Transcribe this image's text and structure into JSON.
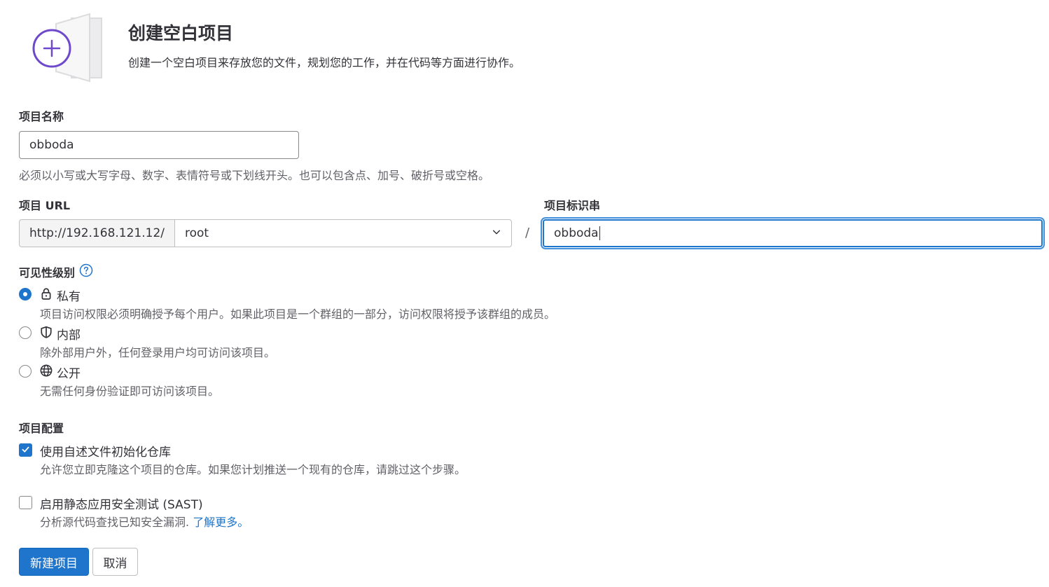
{
  "header": {
    "title": "创建空白项目",
    "description": "创建一个空白项目来存放您的文件，规划您的工作，并在代码等方面进行协作。"
  },
  "project_name": {
    "label": "项目名称",
    "value": "obboda",
    "help": "必须以小写或大写字母、数字、表情符号或下划线开头。也可以包含点、加号、破折号或空格。"
  },
  "project_url": {
    "label": "项目 URL",
    "prefix": "http://192.168.121.12/",
    "namespace": "root",
    "separator": "/"
  },
  "project_slug": {
    "label": "项目标识串",
    "value": "obboda"
  },
  "visibility": {
    "label": "可见性级别",
    "options": [
      {
        "label": "私有",
        "help": "项目访问权限必须明确授予每个用户。如果此项目是一个群组的一部分，访问权限将授予该群组的成员。",
        "icon": "lock-icon",
        "selected": true
      },
      {
        "label": "内部",
        "help": "除外部用户外，任何登录用户均可访问该项目。",
        "icon": "shield-icon",
        "selected": false
      },
      {
        "label": "公开",
        "help": "无需任何身份验证即可访问该项目。",
        "icon": "globe-icon",
        "selected": false
      }
    ]
  },
  "config": {
    "label": "项目配置",
    "readme": {
      "label": "使用自述文件初始化仓库",
      "help": "允许您立即克隆这个项目的仓库。如果您计划推送一个现有的仓库，请跳过这个步骤。",
      "checked": true
    },
    "sast": {
      "label": "启用静态应用安全测试 (SAST)",
      "help": "分析源代码查找已知安全漏洞.",
      "link": "了解更多。",
      "checked": false
    }
  },
  "actions": {
    "create": "新建项目",
    "cancel": "取消"
  },
  "colors": {
    "primary": "#1f75cb",
    "illustration_accent": "#6e49cb"
  }
}
